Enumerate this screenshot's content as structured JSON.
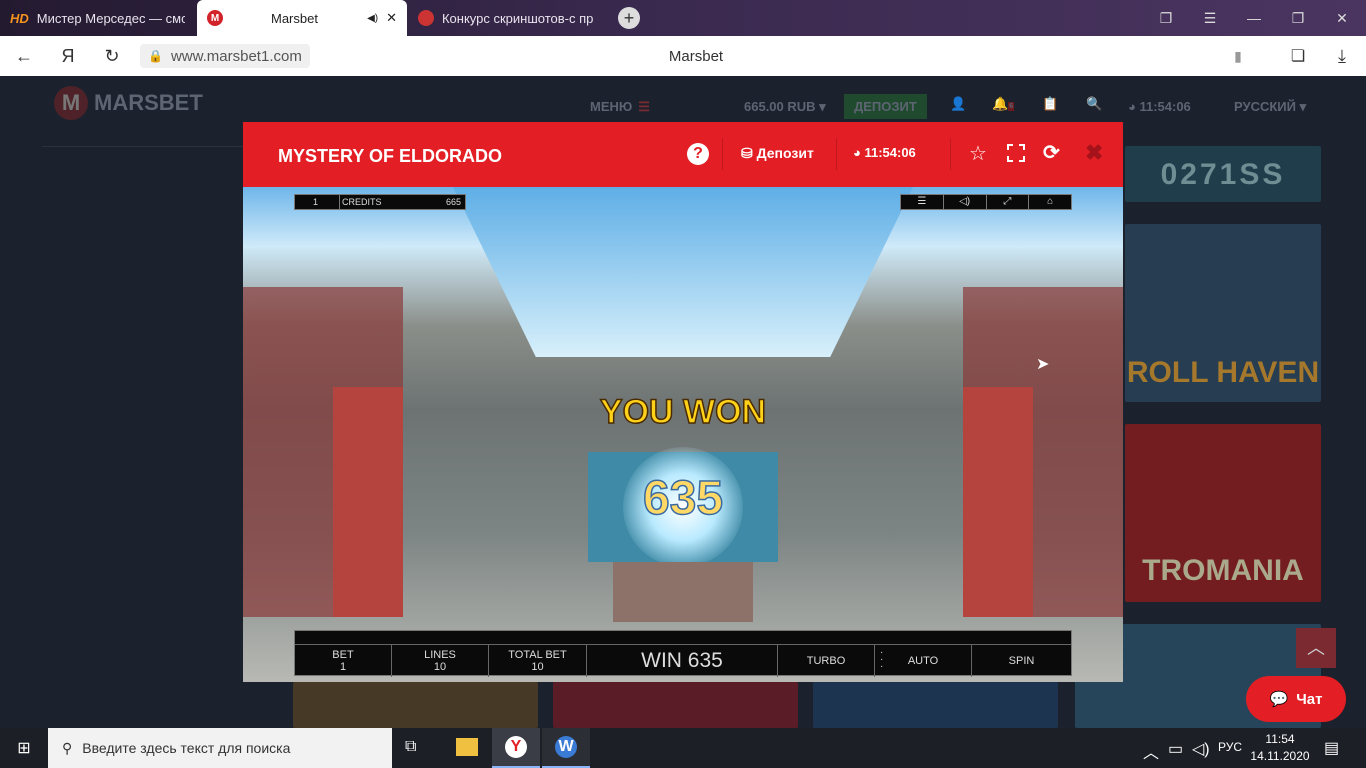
{
  "browser": {
    "tabs": [
      {
        "title": "Мистер Мерседес — смо"
      },
      {
        "title": "Marsbet"
      },
      {
        "title": "Конкурс скриншотов-с пр"
      }
    ],
    "url": "www.marsbet1.com",
    "page_title": "Marsbet"
  },
  "site": {
    "logo": "MARSBET",
    "menu": "МЕНЮ",
    "balance": "665.00 RUB",
    "deposit": "ДЕПОЗИТ",
    "notif": "6",
    "time": "11:54:06",
    "lang": "РУССКИЙ",
    "thumbs": [
      "0271SS",
      "ROLL HAVEN",
      "TROMANIA"
    ]
  },
  "modal": {
    "title": "MYSTERY OF ELDORADO",
    "deposit": "Депозит",
    "time": "11:54:06"
  },
  "game": {
    "bet_count": "1",
    "credits_label": "CREDITS",
    "credits": "665",
    "you_won": "YOU WON",
    "win_amount": "635",
    "bet_label": "BET",
    "bet": "1",
    "lines_label": "LINES",
    "lines": "10",
    "total_bet_label": "TOTAL BET",
    "total_bet": "10",
    "win": "WIN 635",
    "turbo": "TURBO",
    "auto": "AUTO",
    "spin": "SPIN"
  },
  "chat": {
    "label": "Чат"
  },
  "taskbar": {
    "search_placeholder": "Введите здесь текст для поиска",
    "lang": "РУС",
    "time": "11:54",
    "date": "14.11.2020"
  }
}
